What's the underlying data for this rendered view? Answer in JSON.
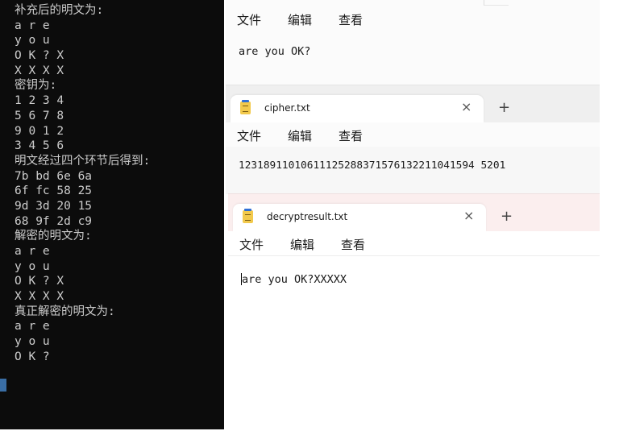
{
  "console": {
    "lines": [
      "补充后的明文为:",
      "a r e",
      "y o u",
      "O K ? X",
      "X X X X",
      "密钥为:",
      "1 2 3 4",
      "5 6 7 8",
      "9 0 1 2",
      "3 4 5 6",
      "明文经过四个环节后得到:",
      "7b bd 6e 6a",
      "6f fc 58 25",
      "9d 3d 20 15",
      "68 9f 2d c9",
      "解密的明文为:",
      "a r e",
      "y o u",
      "O K ? X",
      "X X X X",
      "真正解密的明文为:",
      "a r e",
      "y o u",
      "O K ?"
    ]
  },
  "windows": {
    "plaintext": {
      "menu": [
        "文件",
        "编辑",
        "查看"
      ],
      "content": "are you OK?"
    },
    "cipher": {
      "tab_title": "cipher.txt",
      "close_glyph": "×",
      "plus_glyph": "+",
      "menu": [
        "文件",
        "编辑",
        "查看"
      ],
      "content": "12318911010611125288371576132211041594 5201"
    },
    "decrypt": {
      "tab_title": "decryptresult.txt",
      "close_glyph": "×",
      "plus_glyph": "+",
      "menu": [
        "文件",
        "编辑",
        "查看"
      ],
      "content": "are you OK?XXXXX"
    }
  },
  "icons": {
    "notepad": "notepad-icon",
    "close": "close-icon",
    "add": "plus-icon"
  }
}
